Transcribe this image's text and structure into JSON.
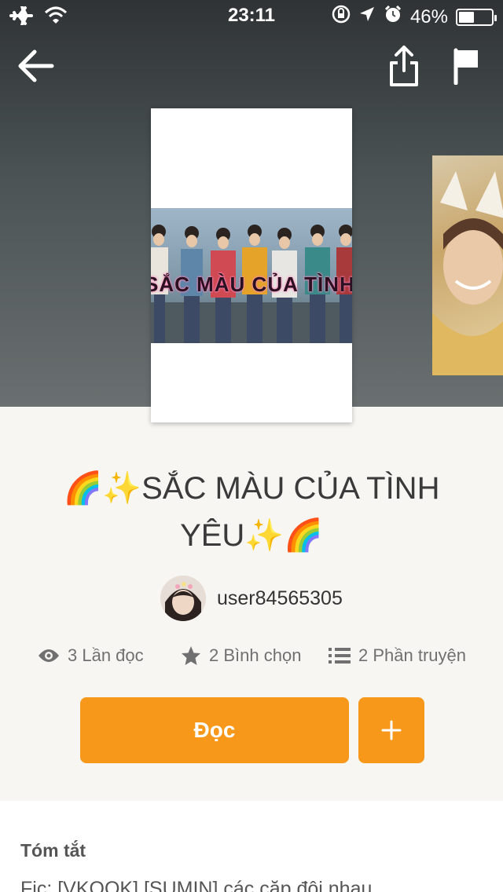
{
  "status_bar": {
    "time": "23:11",
    "battery_text": "46%",
    "battery_level": 0.46,
    "icons": [
      "airplane-icon",
      "wifi-icon",
      "rotation-lock-icon",
      "location-icon",
      "alarm-icon",
      "battery-icon"
    ]
  },
  "header": {
    "icons": [
      "back-arrow-icon",
      "share-icon",
      "flag-icon"
    ]
  },
  "cover": {
    "caption": "SẮC MÀU CỦA TÌNH YÊ"
  },
  "story": {
    "title": "🌈✨SẮC MÀU CỦA TÌNH YÊU✨🌈",
    "author": "user84565305"
  },
  "stats": {
    "reads": "3 Lần đọc",
    "votes": "2 Bình chọn",
    "parts": "2 Phần truyện",
    "icons": [
      "eye-icon",
      "star-icon",
      "list-icon"
    ]
  },
  "actions": {
    "read_label": "Đọc",
    "add_symbol": "+"
  },
  "summary": {
    "heading": "Tóm tắt",
    "text": "Fic: [VKOOK] [SUMIN] các cặp đôi nhau"
  },
  "colors": {
    "accent": "#f7981a",
    "background": "#f7f6f2"
  }
}
